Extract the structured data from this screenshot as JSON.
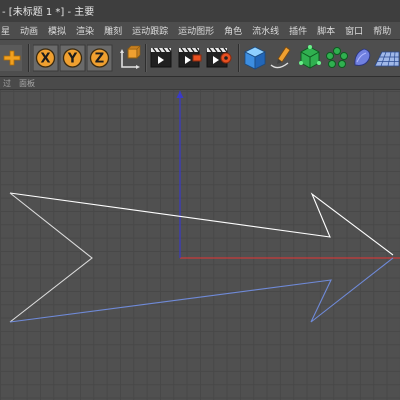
{
  "window": {
    "title": "- [未标题 1 *] - 主要"
  },
  "menu": {
    "items": [
      "星",
      "动画",
      "模拟",
      "渲染",
      "雕刻",
      "运动跟踪",
      "运动图形",
      "角色",
      "流水线",
      "插件",
      "脚本",
      "窗口",
      "帮助"
    ]
  },
  "toolbar": {
    "axis_x": "X",
    "axis_y": "Y",
    "axis_z": "Z",
    "icons": [
      "move-icon",
      "axis-x-lock",
      "axis-y-lock",
      "axis-z-lock",
      "coordinate-system-icon",
      "render-view-icon",
      "render-picture-viewer-icon",
      "render-settings-icon",
      "cube-icon",
      "pen-icon",
      "subdivision-icon",
      "array-icon",
      "deformer-icon",
      "floor-icon"
    ]
  },
  "viewport": {
    "header_items": [
      "过",
      "面板"
    ],
    "axis_colors": {
      "x": "#c83a3a",
      "y": "#3a3ac8"
    },
    "spline_color": "#ffffff",
    "selection_color": "#6f8ad8"
  }
}
